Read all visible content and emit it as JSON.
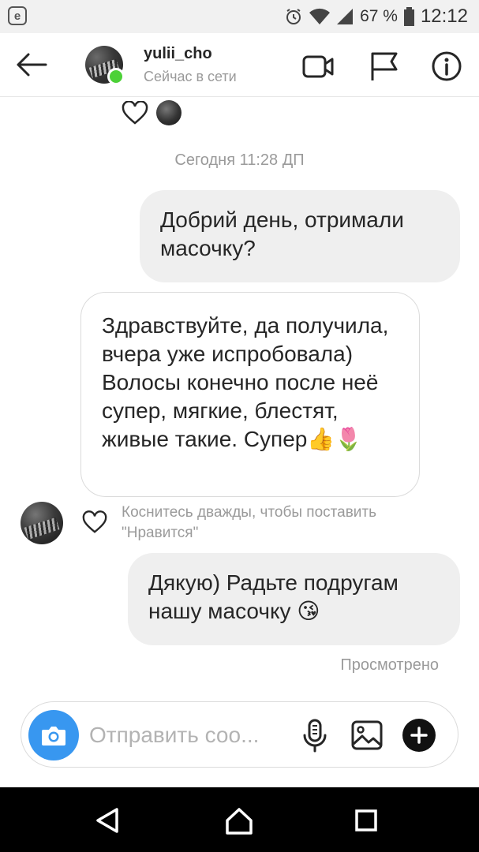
{
  "status_bar": {
    "app_icon_letter": "e",
    "battery_percent": "67 %",
    "time": "12:12"
  },
  "header": {
    "username": "yulii_cho",
    "status": "Сейчас в сети"
  },
  "chat": {
    "date_separator": "Сегодня 11:28 ДП",
    "messages": [
      {
        "direction": "outgoing",
        "text": "Добрий день, отримали масочку?"
      },
      {
        "direction": "incoming",
        "text": "Здравствуйте, да получила, вчера уже испробовала) Волосы конечно после неё супер, мягкие, блестят, живые такие. Супер👍🌷"
      },
      {
        "direction": "outgoing",
        "text": "Дякую) Радьте подругам нашу масочку 😘"
      }
    ],
    "like_hint": "Коснитесь дважды, чтобы поставить \"Нравится\"",
    "seen_label": "Просмотрено"
  },
  "composer": {
    "placeholder": "Отправить соо..."
  },
  "icons": {
    "back": "arrow-left-icon",
    "video": "video-camera-icon",
    "flag": "flag-icon",
    "info": "info-icon",
    "heart": "heart-icon",
    "camera": "camera-icon",
    "mic": "microphone-icon",
    "gallery": "image-icon",
    "plus": "plus-icon"
  },
  "colors": {
    "accent": "#3897f0",
    "online": "#4cd137",
    "bubble_outgoing": "#efefef"
  }
}
